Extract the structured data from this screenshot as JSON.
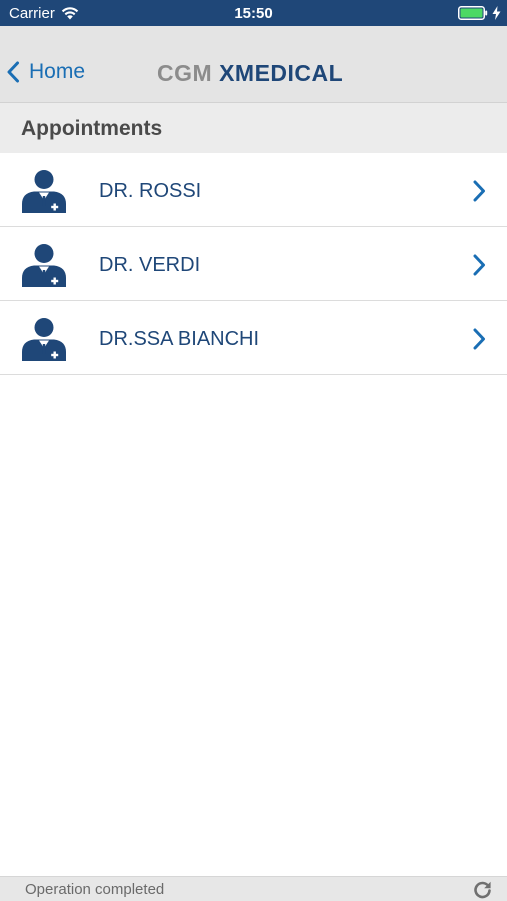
{
  "status_bar": {
    "carrier": "Carrier",
    "time": "15:50",
    "icons": [
      "wifi-icon",
      "battery-icon",
      "charging-bolt-icon"
    ]
  },
  "nav": {
    "back_label": "Home",
    "brand_part1": "CGM ",
    "brand_part2": "XMEDICAL"
  },
  "section": {
    "title": "Appointments"
  },
  "doctors": [
    {
      "name": "DR. ROSSI",
      "icon": "doctor-icon"
    },
    {
      "name": "DR. VERDI",
      "icon": "doctor-icon"
    },
    {
      "name": "DR.SSA BIANCHI",
      "icon": "doctor-icon"
    }
  ],
  "footer": {
    "status": "Operation completed",
    "icon": "refresh-icon"
  },
  "colors": {
    "status_bar_bg": "#1f4778",
    "accent_blue": "#1a6eb4",
    "doctor_name": "#1f4778",
    "battery_green": "#4cd964"
  }
}
